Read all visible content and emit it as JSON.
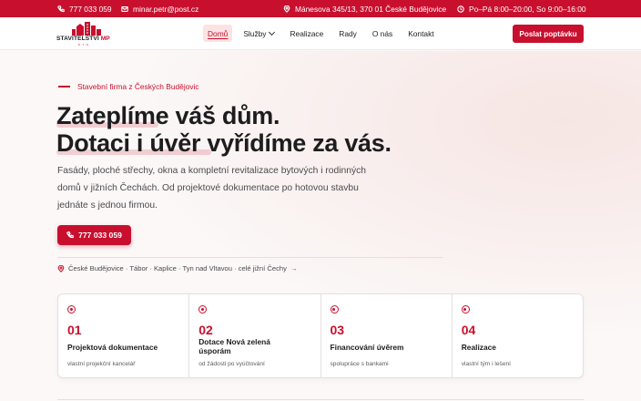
{
  "topbar": {
    "phone": "777 033 059",
    "email": "minar.petr@post.cz",
    "address": "Mánesova 345/13, 370 01 České Budějovice",
    "hours": "Po–Pá 8:00–20:00, So 9:00–16:00",
    "icons": [
      "phone-icon",
      "mail-icon",
      "location-pin-icon",
      "clock-icon"
    ]
  },
  "header": {
    "logo_text": "STAVITELSTVÍ",
    "logo_mp": "MP",
    "logo_sub": "s.r.o.",
    "nav": [
      {
        "label": "Domů",
        "active": true
      },
      {
        "label": "Služby",
        "dropdown": true
      },
      {
        "label": "Realizace"
      },
      {
        "label": "Rady"
      },
      {
        "label": "O nás"
      },
      {
        "label": "Kontakt"
      }
    ],
    "cta": "Poslat poptávku"
  },
  "hero": {
    "kicker": "Stavební firma z Českých Budějovic",
    "title_line1": "Zateplíme váš dům.",
    "title_line2": "Dotaci i úvěr vyřídíme za vás.",
    "lead_line1": "Fasády, ploché střechy, okna a kompletní revitalizace bytových i rodinných",
    "lead_line2": "domů v jižních Čechách. Od projektové dokumentace po hotovou stavbu",
    "lead_line3": "jednáte s jednou firmou.",
    "phone_button": "777 033 059",
    "locations": "České Budějovice · Tábor · Kaplice · Tyn nad Vltavou · celé jižní Čechy",
    "locations_arrow": "→"
  },
  "steps": [
    {
      "num": "01",
      "title": "Projektová dokumentace",
      "desc": "vlastní projekční kancelář"
    },
    {
      "num": "02",
      "title": "Dotace Nová zelená úsporám",
      "desc": "od žádosti po vyúčtování"
    },
    {
      "num": "03",
      "title": "Financování úvěrem",
      "desc": "spolupráce s bankami"
    },
    {
      "num": "04",
      "title": "Realizace",
      "desc": "vlastní tým i lešení"
    }
  ],
  "colors": {
    "accent": "#c8102e",
    "background": "#fbf8f7",
    "text": "#1d1d1f"
  }
}
